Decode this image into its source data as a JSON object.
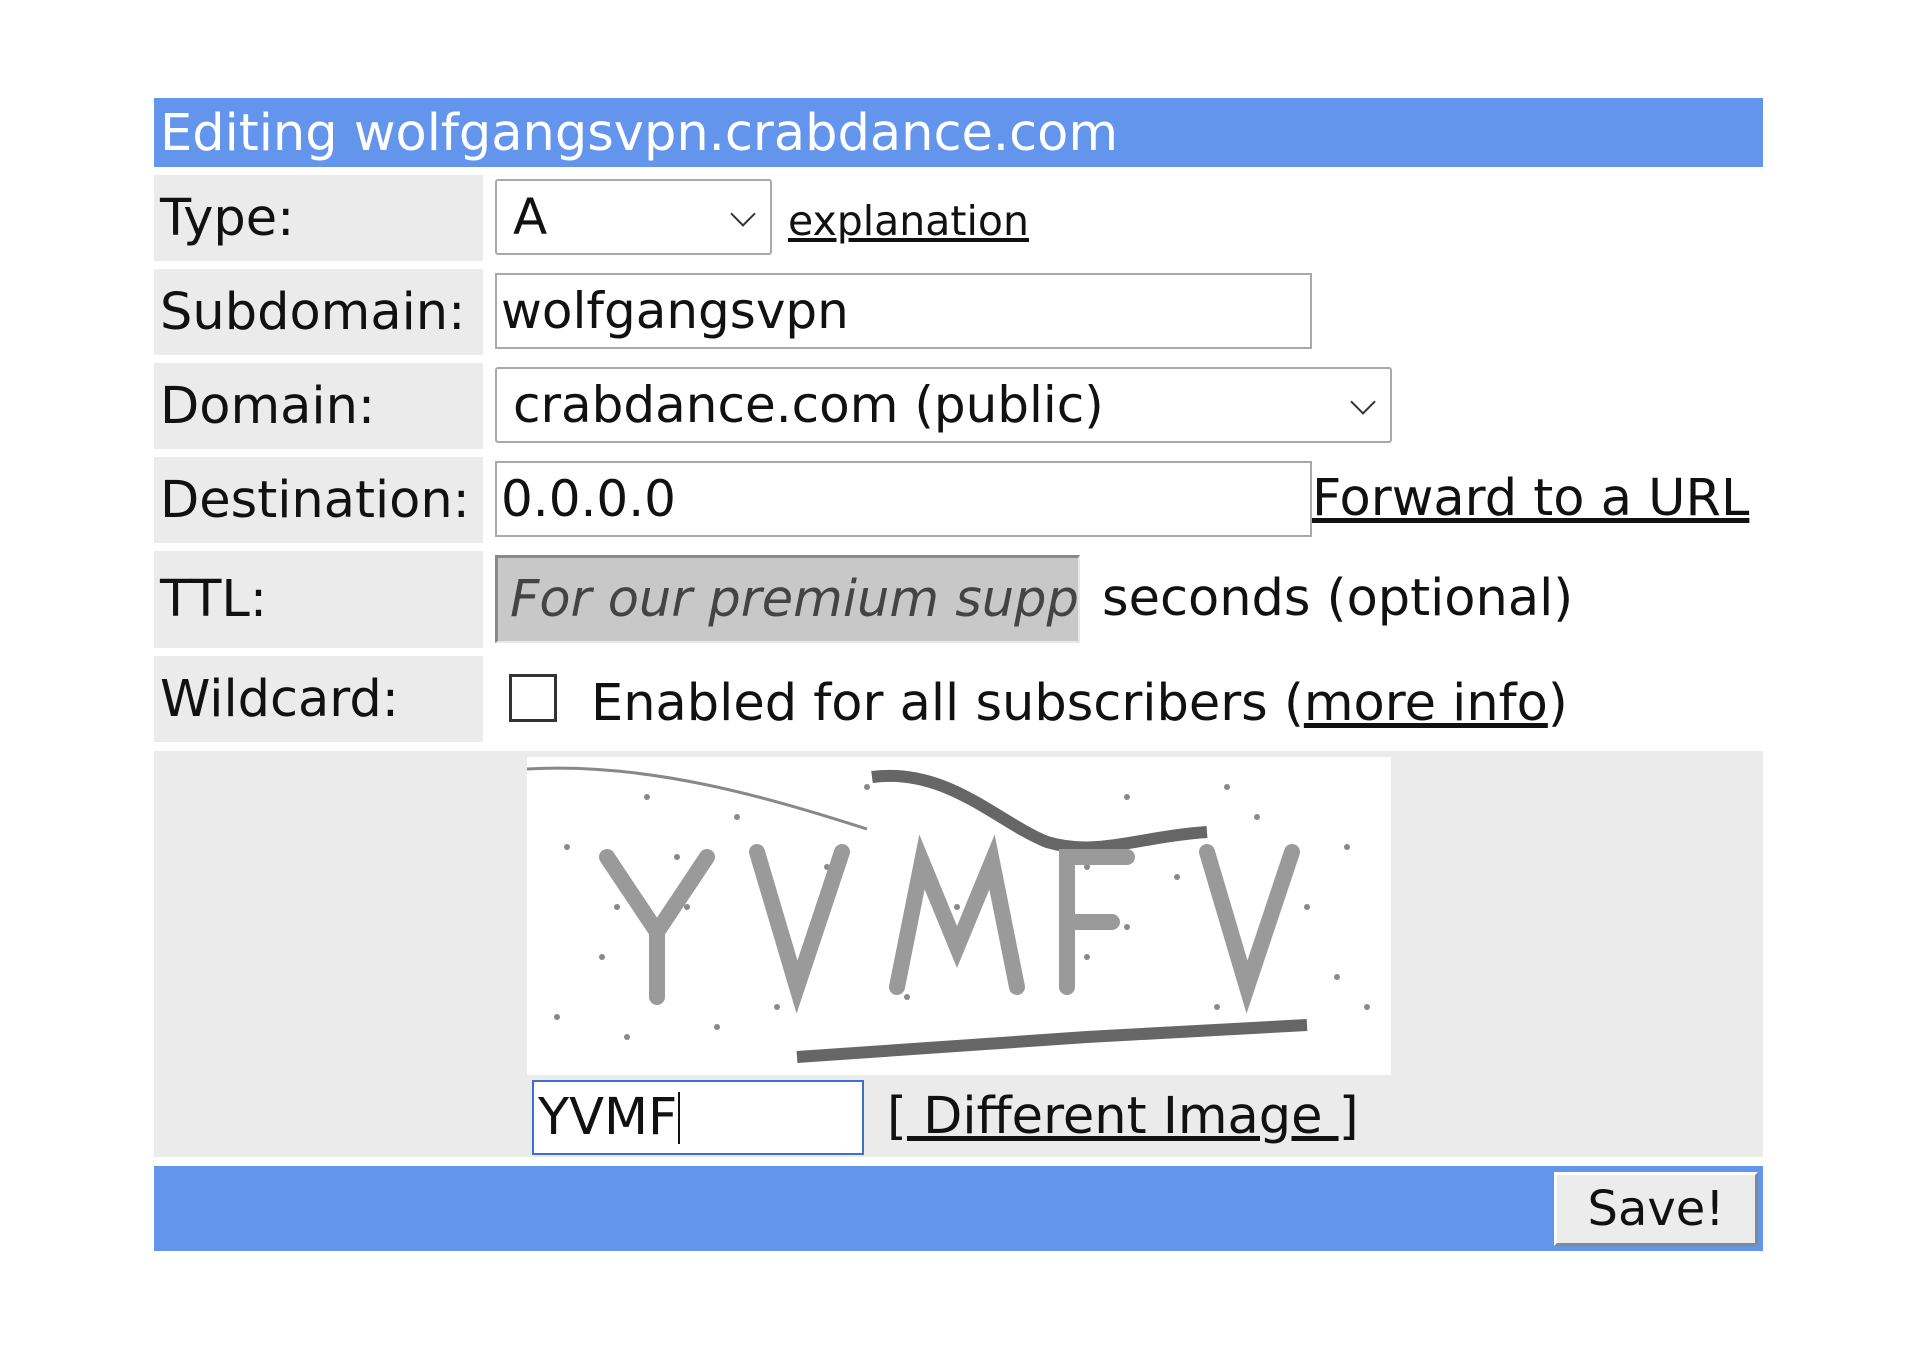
{
  "header": {
    "title": "Editing wolfgangsvpn.crabdance.com"
  },
  "type_row": {
    "label": "Type:",
    "value": "A",
    "link": "explanation"
  },
  "subdomain_row": {
    "label": "Subdomain:",
    "value": "wolfgangsvpn"
  },
  "domain_row": {
    "label": "Domain:",
    "value": "crabdance.com (public)"
  },
  "destination_row": {
    "label": "Destination:",
    "value": "0.0.0.0",
    "link": "Forward to a URL"
  },
  "ttl_row": {
    "label": "TTL:",
    "placeholder": "For our premium supporters",
    "suffix": "seconds (optional)"
  },
  "wildcard_row": {
    "label": "Wildcard:",
    "checked": false,
    "text": "Enabled for all subscribers (",
    "link": "more info",
    "text_end": ")"
  },
  "captcha": {
    "input_value": "YVMF",
    "different_image_link": "[ Different Image ]"
  },
  "footer": {
    "save_label": "Save!"
  },
  "colors": {
    "accent": "#6495ed",
    "label_bg": "#ebebeb"
  },
  "icons": {
    "dropdown": "chevron-down-icon",
    "checkbox": "checkbox-icon"
  }
}
